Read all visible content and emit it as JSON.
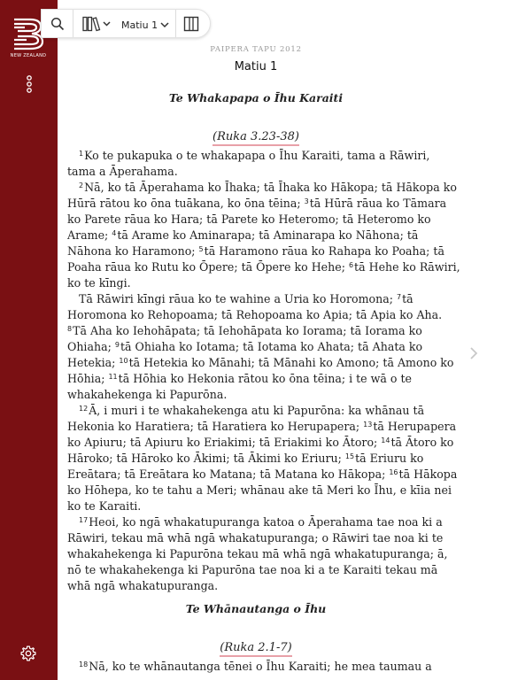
{
  "sidebar": {
    "logo_text": "NEW ZEALAND",
    "background": "#7a1013",
    "icons": [
      "bible-society-logo",
      "more-vertical-icon",
      "settings-icon"
    ]
  },
  "toolbar": {
    "book_label": "Matiu 1",
    "icons": [
      "search-icon",
      "library-icon",
      "chevron-down-icon",
      "panels-icon"
    ]
  },
  "content": {
    "edition": "PAIPERA TAPU 2012",
    "chapter_title": "Matiu 1",
    "section1": {
      "heading": "Te Whakapapa o Īhu Karaiti",
      "xref": "(Ruka 3.23-38)"
    },
    "p1": {
      "v1": "1",
      "l1": "Ko te pukapuka o te whakapapa o Īhu Karaiti, tama a Rāwiri,",
      "l2": "tama a Āperahama."
    },
    "p2": {
      "v2": "2",
      "l1": "Nā, ko tā Āperahama ko Īhaka; tā Īhaka ko Hākopa; tā Hākopa ko",
      "l2a": "Hūrā rātou ko ōna tuākana, ko ōna tēina; ",
      "v3": "3",
      "l2b": "tā Hūrā rāua ko Tāmara",
      "l3": "ko Parete rāua ko Hara; tā Parete ko Heteromo; tā Heteromo ko",
      "l4a": "Arame; ",
      "v4": "4",
      "l4b": "tā Arame ko Aminarapa; tā Aminarapa ko Nāhona; tā",
      "l5a": "Nāhona ko Haramono; ",
      "v5": "5",
      "l5b": "tā Haramono rāua ko Rahapa ko Poaha; tā",
      "l6a": "Poaha rāua ko Rutu ko Ōpere; tā Ōpere ko Hehe; ",
      "v6": "6",
      "l6b": "tā Hehe ko Rāwiri,",
      "l7": "ko te kīngi."
    },
    "p3": {
      "l1": "Tā Rāwiri kīngi rāua ko te wahine a Uria ko Horomona; ",
      "v7": "7",
      "l1b": "tā",
      "l2": "Horomona ko Rehopoama; tā Rehopoama ko Apia; tā Apia ko Aha.",
      "v8": "8",
      "l3": "Tā Aha ko Iehohāpata; tā Iehohāpata ko Iorama; tā Iorama ko",
      "l4a": "Ohiaha; ",
      "v9": "9",
      "l4b": "tā Ohiaha ko Iotama; tā Iotama ko Ahata; tā Ahata ko",
      "l5a": "Hetekia; ",
      "v10": "10",
      "l5b": "tā Hetekia ko Mānahi; tā Mānahi ko Amono; tā Amono ko",
      "l6a": "Hōhia; ",
      "v11": "11",
      "l6b": "tā Hōhia ko Hekonia rātou ko ōna tēina; i te wā o te",
      "l7": "whakahekenga ki Papurōna."
    },
    "p4": {
      "v12": "12",
      "l1": "Ā, i muri i te whakahekenga atu ki Papurōna: ka whānau tā",
      "l2a": "Hekonia ko Haratiera; tā Haratiera ko Herupapera; ",
      "v13": "13",
      "l2b": "tā Herupapera",
      "l3a": "ko Apiuru; tā Apiuru ko Eriakimi; tā Eriakimi ko Ātoro; ",
      "v14": "14",
      "l3b": "tā Ātoro ko",
      "l4a": "Hāroko; tā Hāroko ko Ākimi; tā Ākimi ko Eriuru; ",
      "v15": "15",
      "l4b": "tā Eriuru ko",
      "l5a": "Ereātara; tā Ereātara ko Matana; tā Matana ko Hākopa; ",
      "v16": "16",
      "l5b": "tā Hākopa",
      "l6": "ko Hōhepa, ko te tahu a Meri; whānau ake tā Meri ko Īhu, e kīia nei",
      "l7": "ko te Karaiti."
    },
    "p5": {
      "v17": "17",
      "l1": "Heoi, ko ngā whakatupuranga katoa o Āperahama tae noa ki a",
      "l2": "Rāwiri, tekau mā whā ngā whakatupuranga; o Rāwiri tae noa ki te",
      "l3": "whakahekenga ki Papurōna tekau mā whā ngā whakatupuranga; ā,",
      "l4": "nō te whakahekenga ki Papurōna tae noa ki a te Karaiti tekau mā",
      "l5": "whā ngā whakatupuranga."
    },
    "section2": {
      "heading": "Te Whānautanga o Īhu",
      "xref": "(Ruka 2.1-7)"
    },
    "p6": {
      "v18": "18",
      "l1": "Nā, ko te whānautanga tēnei o Īhu Karaiti; he mea taumau a"
    }
  },
  "colors": {
    "accent": "#7a1013",
    "xref_underline": "#e8a0a8"
  }
}
